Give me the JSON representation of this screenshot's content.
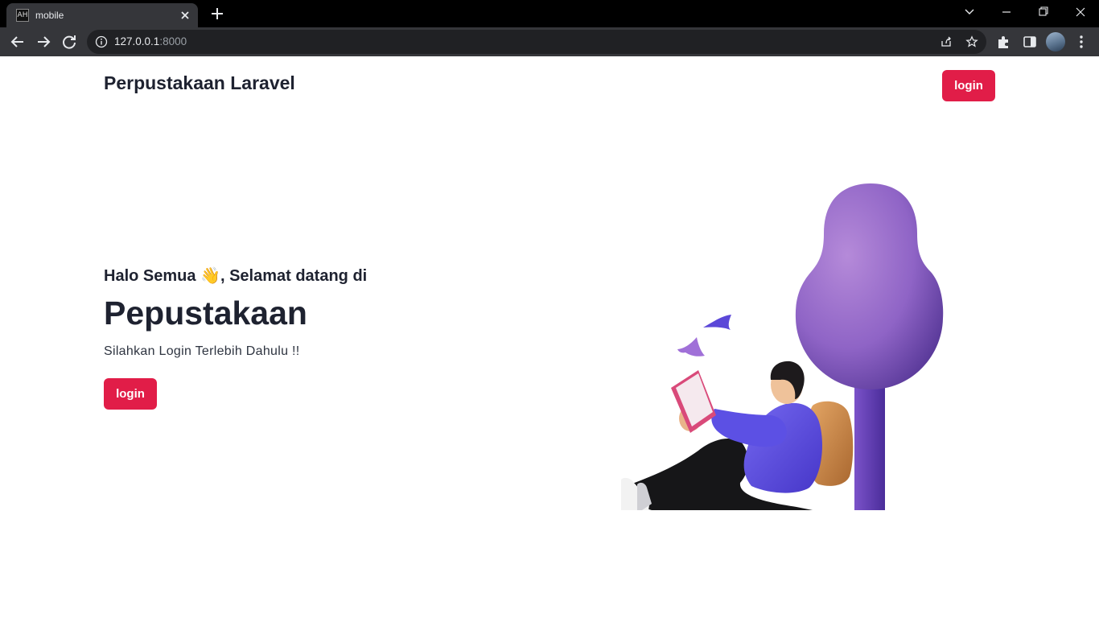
{
  "browser": {
    "tab_title": "mobile",
    "favicon_text": "AH",
    "tab_close_icon": "close-icon",
    "new_tab_icon": "plus-icon",
    "url_host": "127.0.0.1",
    "url_port": ":8000",
    "window_controls": [
      "chevron-down-icon",
      "minimize-icon",
      "restore-icon",
      "close-icon"
    ],
    "nav_icons": [
      "back-arrow-icon",
      "forward-arrow-icon",
      "reload-icon"
    ],
    "toolbar_icons": [
      "share-icon",
      "star-icon",
      "puzzle-icon",
      "sidepanel-icon",
      "avatar",
      "kebab-menu-icon"
    ]
  },
  "navbar": {
    "brand": "Perpustakaan Laravel",
    "login_label": "login"
  },
  "hero": {
    "greeting_before": "Halo Semua ",
    "greeting_emoji": "👋",
    "greeting_after": ", Selamat datang di",
    "title": "Pepustakaan",
    "subtitle": "Silahkan Login Terlebih Dahulu !!",
    "login_label": "login"
  },
  "colors": {
    "accent": "#e11d48",
    "text_dark": "#1e2230",
    "tree_purple": "#9b6fcf",
    "hoodie_blue": "#5b4fe0",
    "tabbar_bg": "#000000",
    "toolbar_bg": "#35363a",
    "omnibox_bg": "#202124"
  }
}
